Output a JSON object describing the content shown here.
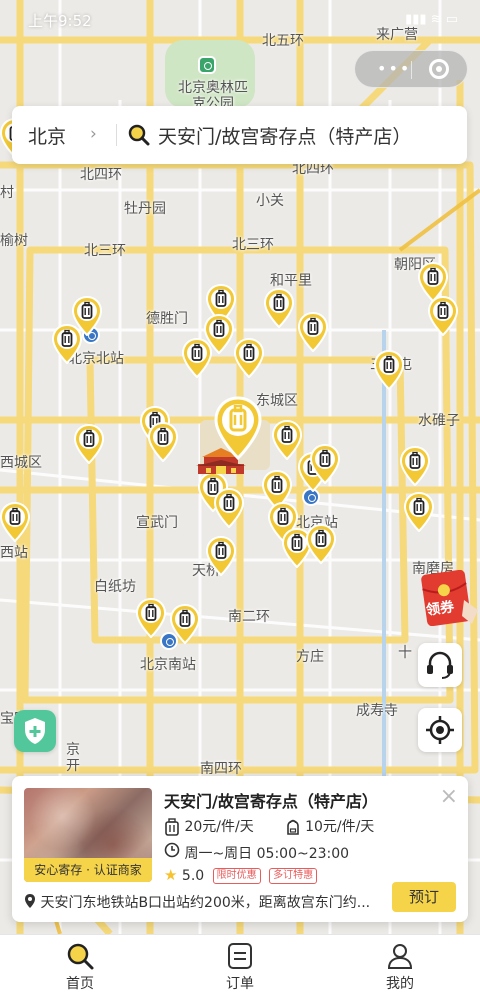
{
  "status_bar": {
    "time": "上午9:52",
    "icons": "▮▮▮ ≋ ▭"
  },
  "capsule": {
    "more_label": "•••"
  },
  "search": {
    "city": "北京",
    "chevron": "›",
    "query": "天安门/故宫寄存点（特产店）"
  },
  "map": {
    "labels": [
      {
        "text": "北五环",
        "cls": "ring"
      },
      {
        "text": "来广营",
        "cls": ""
      },
      {
        "text": "北京奥林匹克公园",
        "cls": ""
      },
      {
        "text": "北四环",
        "cls": "ring"
      },
      {
        "text": "北四环",
        "cls": "ring"
      },
      {
        "text": "牡丹园",
        "cls": ""
      },
      {
        "text": "小关",
        "cls": ""
      },
      {
        "text": "北三环",
        "cls": "ring"
      },
      {
        "text": "北三环",
        "cls": "ring"
      },
      {
        "text": "朝阳区",
        "cls": ""
      },
      {
        "text": "和平里",
        "cls": ""
      },
      {
        "text": "德胜门",
        "cls": ""
      },
      {
        "text": "北京北站",
        "cls": ""
      },
      {
        "text": "三元屯",
        "cls": ""
      },
      {
        "text": "东城区",
        "cls": ""
      },
      {
        "text": "水碓子",
        "cls": ""
      },
      {
        "text": "西城区",
        "cls": ""
      },
      {
        "text": "宣武门",
        "cls": ""
      },
      {
        "text": "北京站",
        "cls": ""
      },
      {
        "text": "西站",
        "cls": ""
      },
      {
        "text": "白纸坊",
        "cls": ""
      },
      {
        "text": "天桥",
        "cls": ""
      },
      {
        "text": "南磨房",
        "cls": ""
      },
      {
        "text": "南二环",
        "cls": "ring"
      },
      {
        "text": "北京南站",
        "cls": ""
      },
      {
        "text": "方庄",
        "cls": ""
      },
      {
        "text": "十",
        "cls": ""
      },
      {
        "text": "成寿寺",
        "cls": ""
      },
      {
        "text": "南四环",
        "cls": "ring"
      },
      {
        "text": "宝家",
        "cls": ""
      },
      {
        "text": "榆树",
        "cls": ""
      },
      {
        "text": "村",
        "cls": ""
      },
      {
        "text": "京开",
        "cls": ""
      }
    ]
  },
  "coupon": {
    "label": "领券"
  },
  "card": {
    "image_badge": "安心寄存 · 认证商家",
    "title": "天安门/故宫寄存点（特产店）",
    "close": "×",
    "price_per_bag_large": "20元/件/天",
    "price_per_bag_small": "10元/件/天",
    "hours": "周一~周日 05:00~23:00",
    "rating": "5.0",
    "tags": [
      "限时优惠",
      "多订特惠"
    ],
    "address": "天安门东地铁站B口出站约200米，距离故宫东门约...",
    "book_label": "预订"
  },
  "tabs": [
    {
      "label": "首页",
      "icon": "search-icon"
    },
    {
      "label": "订单",
      "icon": "order-icon"
    },
    {
      "label": "我的",
      "icon": "user-icon"
    }
  ],
  "colors": {
    "accent": "#f6d44a",
    "pin": "#f2c935",
    "ring_road": "#f6d97a",
    "metro": "#3a76c6"
  }
}
